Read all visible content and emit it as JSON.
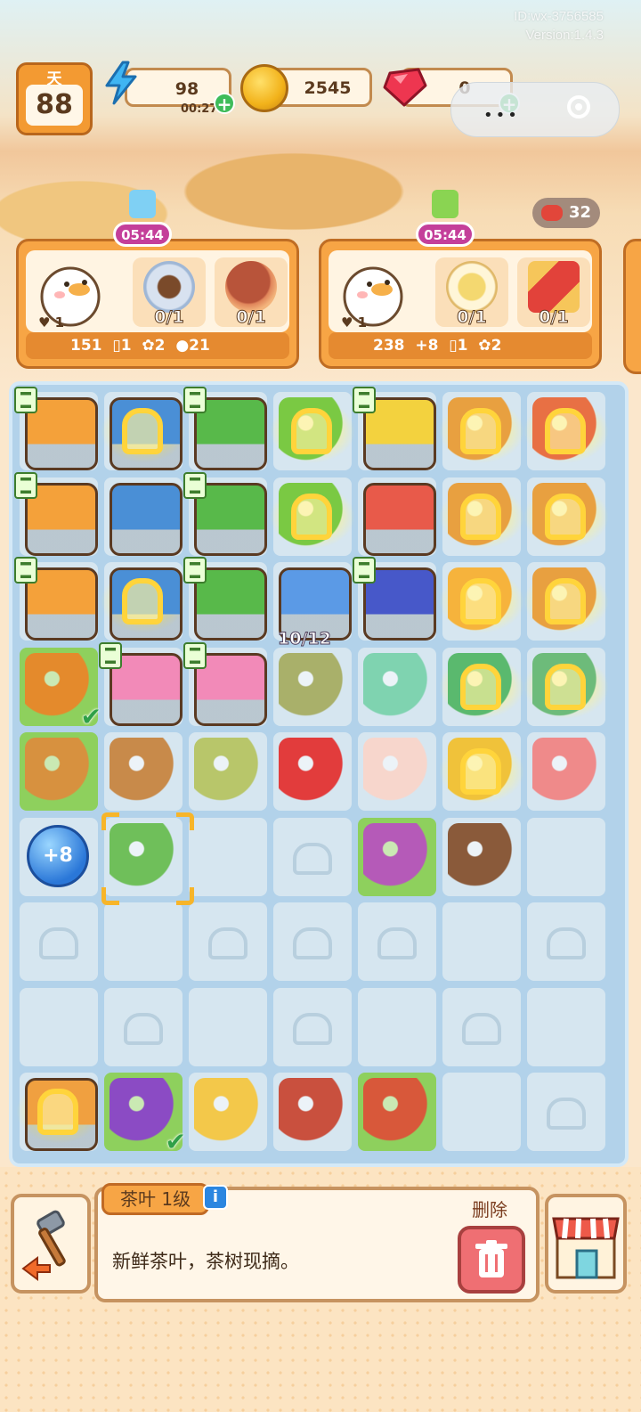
{
  "overlay": {
    "user_id": "ID:wx-3756585",
    "version": "Version:1.4.3"
  },
  "hud": {
    "day_label": "天",
    "day_number": "88",
    "energy": "98",
    "energy_timer": "00:27",
    "coins": "2545",
    "gems": "0",
    "meat_count": "32"
  },
  "orders": [
    {
      "timer": "05:44",
      "hearts": "1",
      "items": [
        {
          "name": "coffee-dessert",
          "progress": "0/1"
        },
        {
          "name": "donut",
          "progress": "0/1"
        }
      ],
      "rewards": {
        "coins": "151",
        "card": "1",
        "candy": "2",
        "meat": "21"
      }
    },
    {
      "timer": "05:44",
      "hearts": "1",
      "items": [
        {
          "name": "tea-cup",
          "progress": "0/1"
        },
        {
          "name": "pizza-slice",
          "progress": "0/1"
        }
      ],
      "rewards": {
        "coins": "238",
        "bonus": "+8",
        "card": "1",
        "candy": "2"
      }
    }
  ],
  "board": {
    "oven_capacity": "10/12",
    "bubble_label": "+8"
  },
  "item_info": {
    "title": "茶叶 1级",
    "description": "新鲜茶叶，茶树现摘。",
    "delete_label": "删除",
    "info_icon": "i"
  },
  "colors": {
    "accent_orange": "#f7a545",
    "board_blue": "#b2d2ea",
    "tag_purple": "#c43f9a",
    "plus_green": "#3ebc5a"
  }
}
